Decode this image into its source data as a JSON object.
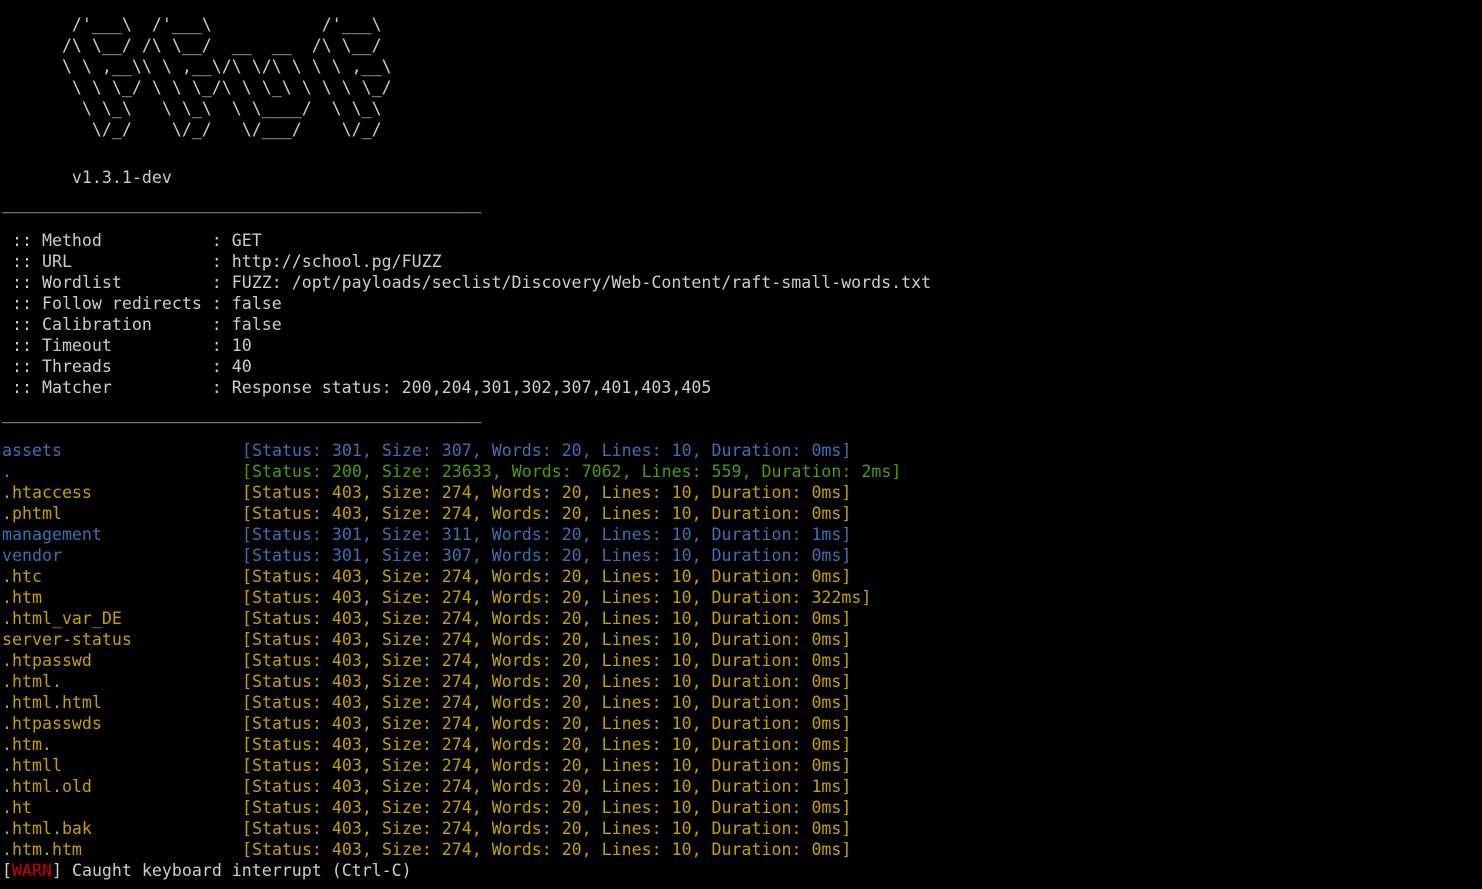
{
  "banner": {
    "art_lines": [
      "       /'___\\  /'___\\           /'___\\       ",
      "      /\\ \\__/ /\\ \\__/  __  __  /\\ \\__/       ",
      "      \\ \\ ,__\\\\ \\ ,__\\/\\ \\/\\ \\ \\ \\ ,__\\      ",
      "       \\ \\ \\_/ \\ \\ \\_/\\ \\ \\_\\ \\ \\ \\ \\_/      ",
      "        \\ \\_\\   \\ \\_\\  \\ \\____/  \\ \\_\\       ",
      "         \\/_/    \\/_/   \\/___/    \\/_/       "
    ],
    "version": "       v1.3.1-dev"
  },
  "separator": "________________________________________________",
  "config": [
    {
      "label": " :: Method           : ",
      "value": "GET"
    },
    {
      "label": " :: URL              : ",
      "value": "http://school.pg/FUZZ"
    },
    {
      "label": " :: Wordlist         : ",
      "value": "FUZZ: /opt/payloads/seclist/Discovery/Web-Content/raft-small-words.txt"
    },
    {
      "label": " :: Follow redirects : ",
      "value": "false"
    },
    {
      "label": " :: Calibration      : ",
      "value": "false"
    },
    {
      "label": " :: Timeout          : ",
      "value": "10"
    },
    {
      "label": " :: Threads          : ",
      "value": "40"
    },
    {
      "label": " :: Matcher          : ",
      "value": "Response status: 200,204,301,302,307,401,403,405"
    }
  ],
  "colors": {
    "background": "#000000",
    "default_text": "#cccccc",
    "status_301": "#3d6fb5",
    "status_200": "#4e9a06",
    "status_403": "#c4a000",
    "warn": "#cc0000"
  },
  "results": [
    {
      "word": "assets",
      "stat": "[Status: 301, Size: 307, Words: 20, Lines: 10, Duration: 0ms]",
      "color": "#3d6fb5"
    },
    {
      "word": ".",
      "stat": "[Status: 200, Size: 23633, Words: 7062, Lines: 559, Duration: 2ms]",
      "color": "#4e9a06"
    },
    {
      "word": ".htaccess",
      "stat": "[Status: 403, Size: 274, Words: 20, Lines: 10, Duration: 0ms]",
      "color": "#c4a000"
    },
    {
      "word": ".phtml",
      "stat": "[Status: 403, Size: 274, Words: 20, Lines: 10, Duration: 0ms]",
      "color": "#c4a000"
    },
    {
      "word": "management",
      "stat": "[Status: 301, Size: 311, Words: 20, Lines: 10, Duration: 1ms]",
      "color": "#3d6fb5"
    },
    {
      "word": "vendor",
      "stat": "[Status: 301, Size: 307, Words: 20, Lines: 10, Duration: 0ms]",
      "color": "#3d6fb5"
    },
    {
      "word": ".htc",
      "stat": "[Status: 403, Size: 274, Words: 20, Lines: 10, Duration: 0ms]",
      "color": "#c4a000"
    },
    {
      "word": ".htm",
      "stat": "[Status: 403, Size: 274, Words: 20, Lines: 10, Duration: 322ms]",
      "color": "#c4a000"
    },
    {
      "word": ".html_var_DE",
      "stat": "[Status: 403, Size: 274, Words: 20, Lines: 10, Duration: 0ms]",
      "color": "#c4a000"
    },
    {
      "word": "server-status",
      "stat": "[Status: 403, Size: 274, Words: 20, Lines: 10, Duration: 0ms]",
      "color": "#c4a000"
    },
    {
      "word": ".htpasswd",
      "stat": "[Status: 403, Size: 274, Words: 20, Lines: 10, Duration: 0ms]",
      "color": "#c4a000"
    },
    {
      "word": ".html.",
      "stat": "[Status: 403, Size: 274, Words: 20, Lines: 10, Duration: 0ms]",
      "color": "#c4a000"
    },
    {
      "word": ".html.html",
      "stat": "[Status: 403, Size: 274, Words: 20, Lines: 10, Duration: 0ms]",
      "color": "#c4a000"
    },
    {
      "word": ".htpasswds",
      "stat": "[Status: 403, Size: 274, Words: 20, Lines: 10, Duration: 0ms]",
      "color": "#c4a000"
    },
    {
      "word": ".htm.",
      "stat": "[Status: 403, Size: 274, Words: 20, Lines: 10, Duration: 0ms]",
      "color": "#c4a000"
    },
    {
      "word": ".htmll",
      "stat": "[Status: 403, Size: 274, Words: 20, Lines: 10, Duration: 0ms]",
      "color": "#c4a000"
    },
    {
      "word": ".html.old",
      "stat": "[Status: 403, Size: 274, Words: 20, Lines: 10, Duration: 1ms]",
      "color": "#c4a000"
    },
    {
      "word": ".ht",
      "stat": "[Status: 403, Size: 274, Words: 20, Lines: 10, Duration: 0ms]",
      "color": "#c4a000"
    },
    {
      "word": ".html.bak",
      "stat": "[Status: 403, Size: 274, Words: 20, Lines: 10, Duration: 0ms]",
      "color": "#c4a000"
    },
    {
      "word": ".htm.htm",
      "stat": "[Status: 403, Size: 274, Words: 20, Lines: 10, Duration: 0ms]",
      "color": "#c4a000"
    }
  ],
  "warning": {
    "open_bracket": "[",
    "tag": "WARN",
    "close_bracket": "]",
    "message": " Caught keyboard interrupt (Ctrl-C)"
  }
}
